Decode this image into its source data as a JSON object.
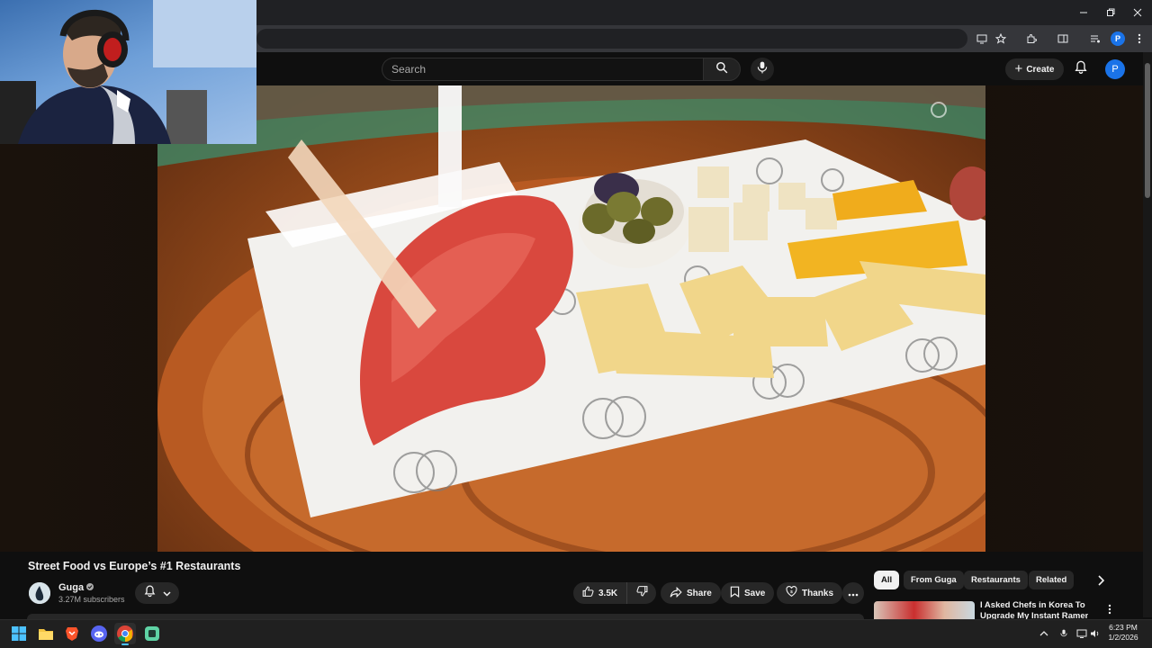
{
  "search": {
    "placeholder": "Search"
  },
  "header": {
    "create_label": "Create",
    "avatar_letter": "P",
    "browser_profile_letter": "P"
  },
  "video": {
    "title": "Street Food vs Europe’s #1 Restaurants",
    "channel": "Guga",
    "subscribers": "3.27M subscribers",
    "likes": "3.5K"
  },
  "actions": {
    "share": "Share",
    "save": "Save",
    "thanks": "Thanks"
  },
  "chips": [
    "All",
    "From Guga",
    "Restaurants",
    "Related"
  ],
  "recommendation": {
    "title_line1": "I Asked Chefs in Korea To",
    "title_line2": "Upgrade My Instant Ramen"
  },
  "taskbar": {
    "time": "6:23 PM",
    "date": "1/2/2026"
  },
  "colors": {
    "accent": "#1a73e8",
    "background": "#0f0f0f",
    "pill": "#272727",
    "taskbar_accent": "#4cc2ff"
  }
}
